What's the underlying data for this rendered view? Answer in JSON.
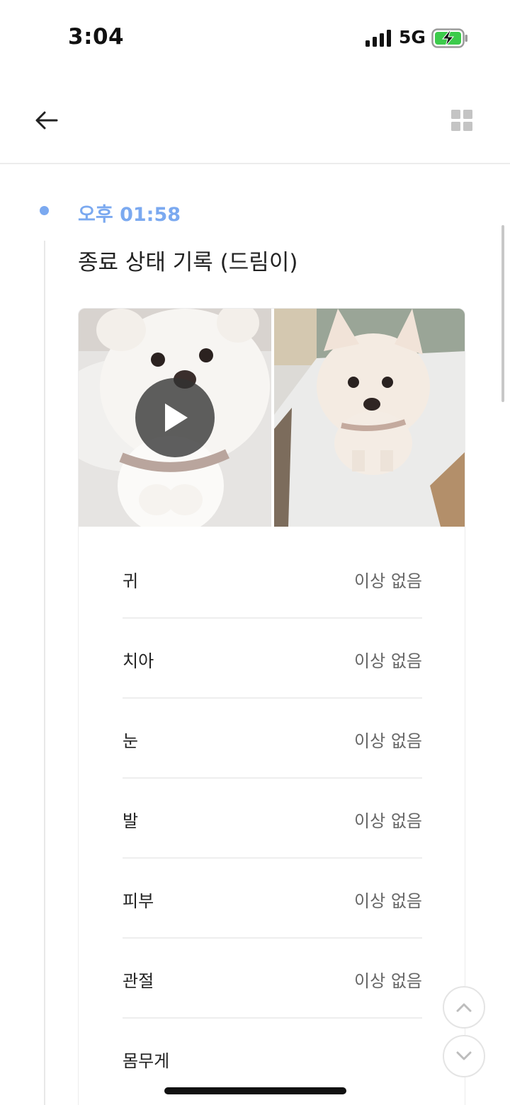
{
  "status_bar": {
    "time": "3:04",
    "network": "5G",
    "icons": [
      "signal-icon",
      "battery-charging-icon"
    ]
  },
  "nav": {
    "back_icon": "arrow-left-icon",
    "grid_icon": "grid-icon"
  },
  "entry": {
    "time": "오후 01:58",
    "title": "종료 상태 기록 (드림이)",
    "accent_color": "#7ba9f0"
  },
  "media": [
    {
      "type": "video",
      "icon": "play-icon"
    },
    {
      "type": "photo"
    }
  ],
  "checks": [
    {
      "label": "귀",
      "value": "이상 없음"
    },
    {
      "label": "치아",
      "value": "이상 없음"
    },
    {
      "label": "눈",
      "value": "이상 없음"
    },
    {
      "label": "발",
      "value": "이상 없음"
    },
    {
      "label": "피부",
      "value": "이상 없음"
    },
    {
      "label": "관절",
      "value": "이상 없음"
    },
    {
      "label": "몸무게",
      "value": ""
    }
  ],
  "scroll_controls": {
    "up_icon": "chevron-up-icon",
    "down_icon": "chevron-down-icon"
  }
}
